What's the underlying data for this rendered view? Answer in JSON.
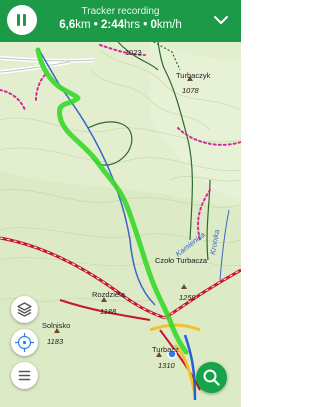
{
  "tracker": {
    "title": "Tracker recording",
    "distance": "6,6",
    "distance_unit": "km",
    "sep1": " • ",
    "duration": "2:44",
    "duration_unit": "hrs",
    "sep2": " • ",
    "speed": "0",
    "speed_unit": "km/h"
  },
  "map_labels": {
    "peak_1023": "1023",
    "turbaczyk": "Turbaczyk",
    "turbaczyk_elev": "1078",
    "czolo_turbacza": "Czoło Turbacza",
    "czolo_elev": "1259",
    "kamienica": "Kamienica",
    "kronika": "Kronika",
    "rozdziele": "Rozdziele",
    "rozdziele_elev": "1188",
    "solnisko": "Solnisko",
    "solnisko_elev": "1183",
    "turbacz": "Turbacz",
    "turbacz_elev": "1310"
  },
  "icons": {
    "pause": "pause-icon",
    "collapse": "chevron-down-icon",
    "layers": "layers-icon",
    "compass": "compass-icon",
    "menu": "menu-icon",
    "search": "search-icon"
  },
  "colors": {
    "header": "#1c9a47",
    "track": "#36d82a",
    "trail_red": "#c8162e",
    "trail_pink": "#d52a9a",
    "road_yellow": "#f3c12b",
    "search_fab": "#17a34a"
  }
}
